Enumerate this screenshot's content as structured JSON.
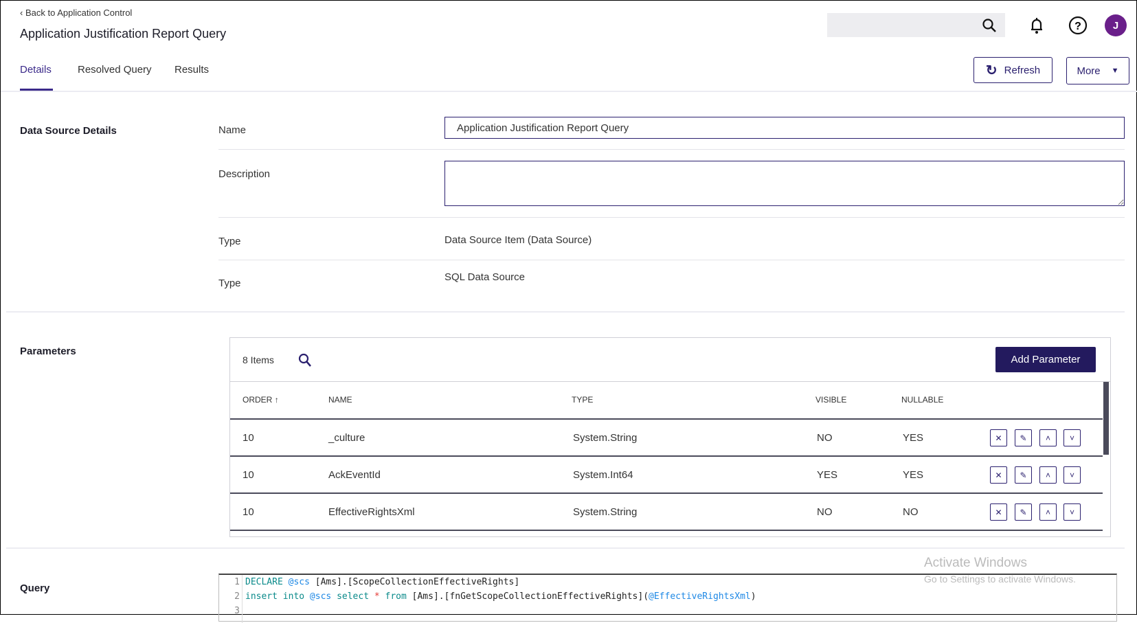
{
  "header": {
    "back_link": "Back to Application Control",
    "title": "Application Justification Report Query",
    "search_placeholder": "",
    "avatar_initial": "J"
  },
  "tabs": [
    {
      "label": "Details",
      "active": true
    },
    {
      "label": "Resolved Query"
    },
    {
      "label": "Results"
    }
  ],
  "actions": {
    "refresh": "Refresh",
    "more": "More"
  },
  "details": {
    "section": "Data Source Details",
    "name_label": "Name",
    "name_value": "Application Justification Report Query",
    "description_label": "Description",
    "description_value": "",
    "type1_label": "Type",
    "type1_value": "Data Source Item (Data Source)",
    "type2_label": "Type",
    "type2_value": "SQL Data Source"
  },
  "parameters": {
    "section": "Parameters",
    "count": "8 Items",
    "add_button": "Add Parameter",
    "columns": [
      "ORDER",
      "NAME",
      "TYPE",
      "VISIBLE",
      "NULLABLE"
    ],
    "rows": [
      {
        "order": "10",
        "name": "_culture",
        "type": "System.String",
        "visible": "NO",
        "nullable": "YES"
      },
      {
        "order": "10",
        "name": "AckEventId",
        "type": "System.Int64",
        "visible": "YES",
        "nullable": "YES"
      },
      {
        "order": "10",
        "name": "EffectiveRightsXml",
        "type": "System.String",
        "visible": "NO",
        "nullable": "NO"
      }
    ]
  },
  "query": {
    "section": "Query",
    "lines": [
      {
        "num": "1",
        "tokens": [
          [
            "kw",
            "DECLARE "
          ],
          [
            "var",
            "@scs "
          ],
          [
            "id",
            "[Ams].[ScopeCollectionEffectiveRights]"
          ]
        ]
      },
      {
        "num": "2",
        "tokens": [
          [
            "kw",
            "insert into "
          ],
          [
            "var",
            "@scs "
          ],
          [
            "kw",
            "select "
          ],
          [
            "op",
            "* "
          ],
          [
            "kw",
            "from "
          ],
          [
            "id",
            "[Ams].[fnGetScopeCollectionEffectiveRights]("
          ],
          [
            "var",
            "@EffectiveRightsXml"
          ],
          [
            "id",
            ")"
          ]
        ]
      },
      {
        "num": "3",
        "tokens": []
      }
    ]
  },
  "watermark": {
    "title": "Activate Windows",
    "subtitle": "Go to Settings to activate Windows."
  },
  "colors": {
    "accent": "#3b2a8a",
    "primary_button": "#231a5e",
    "avatar": "#6a1f8a"
  }
}
